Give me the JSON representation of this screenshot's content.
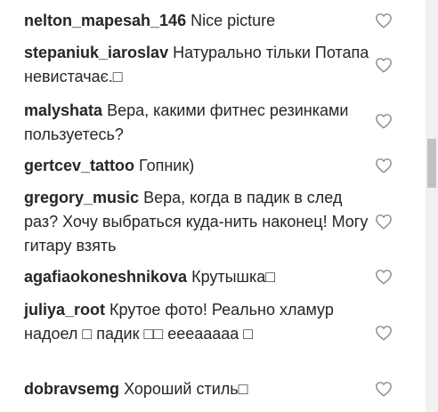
{
  "comments": [
    {
      "username": "nelton_mapesah_146",
      "text": "Nice picture"
    },
    {
      "username": "stepaniuk_iaroslav",
      "text": "Натурально тільки Потапа невистачає.□"
    },
    {
      "username": "malyshata",
      "text": "Вера, какими фитнес резинками пользуетесь?"
    },
    {
      "username": "gertcev_tattoo",
      "text": "Гопник)"
    },
    {
      "username": "gregory_music",
      "text": "Вера, когда в падик в след раз? Хочу выбраться куда-нить наконец! Могу гитару взять"
    },
    {
      "username": "agafiaokoneshnikova",
      "text": "Крутышка□"
    },
    {
      "username": "juliya_root",
      "text": "Крутое фото! Реально хламур надоел □ падик □□ ееeааааа □"
    },
    {
      "username": "dobravsemg",
      "text": "Хороший стиль□"
    }
  ],
  "icons": {
    "like": "heart-outline-icon"
  },
  "colors": {
    "text": "#262626",
    "icon": "#8e8e8e",
    "scrollbar_track": "#f1f1f1",
    "scrollbar_thumb": "#c1c1c1"
  }
}
